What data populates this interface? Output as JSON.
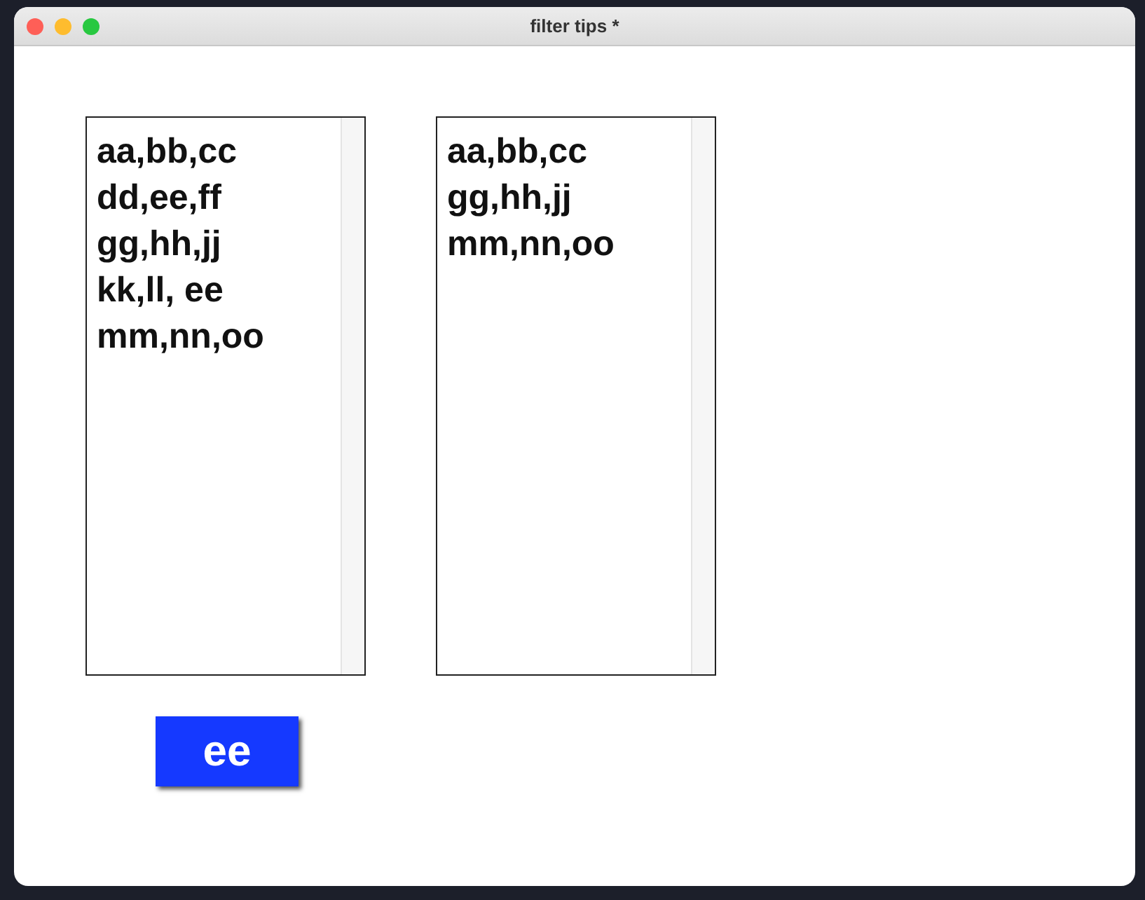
{
  "window": {
    "title": "filter tips *"
  },
  "lists": [
    {
      "items": [
        "aa,bb,cc",
        "dd,ee,ff",
        "gg,hh,jj",
        "kk,ll, ee",
        "mm,nn,oo"
      ]
    },
    {
      "items": [
        "aa,bb,cc",
        "gg,hh,jj",
        "mm,nn,oo"
      ]
    }
  ],
  "button": {
    "label": "ee"
  }
}
